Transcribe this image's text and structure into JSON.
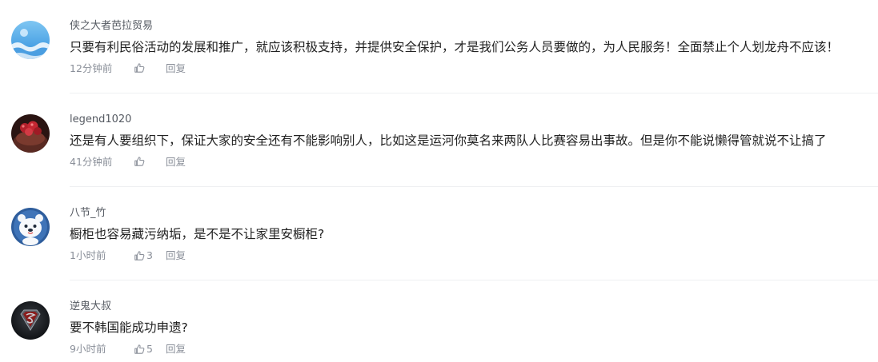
{
  "comments": [
    {
      "username": "侠之大者芭拉贸易",
      "avatar": "blue-sea-avatar",
      "text": "只要有利民俗活动的发展和推广，就应该积极支持，并提供安全保护，才是我们公务人员要做的，为人民服务！全面禁止个人划龙舟不应该！",
      "time": "12分钟前",
      "like_count": "",
      "reply_label": "回复"
    },
    {
      "username": "legend1020",
      "avatar": "red-fruit-avatar",
      "text": "还是有人要组织下，保证大家的安全还有不能影响别人，比如这是运河你莫名来两队人比赛容易出事故。但是你不能说懒得管就说不让搞了",
      "time": "41分钟前",
      "like_count": "",
      "reply_label": "回复"
    },
    {
      "username": "八节_竹",
      "avatar": "cartoon-bear-avatar",
      "text": "橱柜也容易藏污纳垢，是不是不让家里安橱柜?",
      "time": "1小时前",
      "like_count": "3",
      "reply_label": "回复"
    },
    {
      "username": "逆鬼大叔",
      "avatar": "superman-logo-avatar",
      "text": "要不韩国能成功申遗?",
      "time": "9小时前",
      "like_count": "5",
      "reply_label": "回复"
    }
  ],
  "colors": {
    "username": "#555a62",
    "text": "#222222",
    "meta": "#8a8f99",
    "divider": "#eef0f2"
  },
  "icons": {
    "like": "thumbs-up-icon"
  }
}
